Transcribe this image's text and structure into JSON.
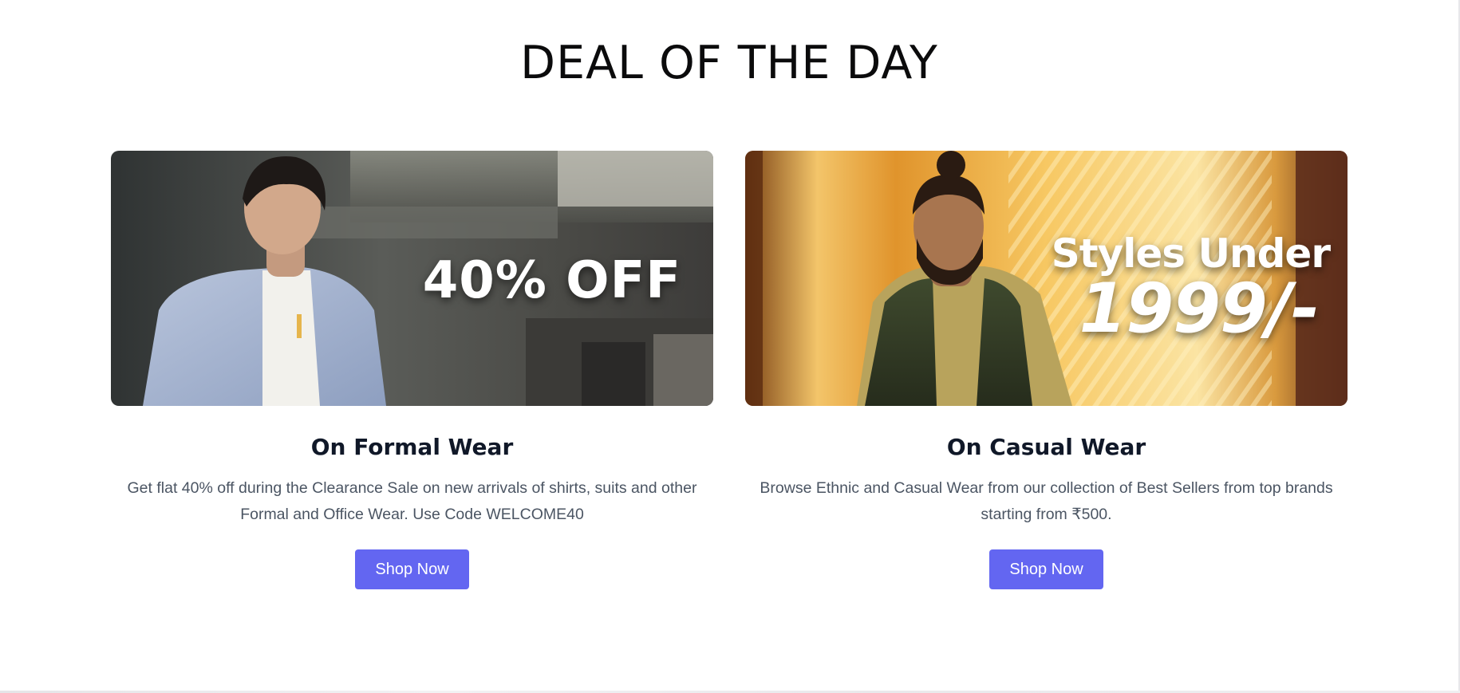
{
  "section": {
    "title": "DEAL OF THE DAY"
  },
  "cards": [
    {
      "banner_text": "40% OFF",
      "title": "On Formal Wear",
      "description": "Get flat 40% off during the Clearance Sale on new arrivals of shirts, suits and other Formal and Office Wear. Use Code WELCOME40",
      "button_label": "Shop Now"
    },
    {
      "banner_text_top": "Styles Under",
      "banner_text_price": "1999/-",
      "title": "On Casual Wear",
      "description": "Browse Ethnic and Casual Wear from our collection of Best Sellers from top brands starting from ₹500.",
      "button_label": "Shop Now"
    }
  ],
  "colors": {
    "accent": "#6366f1",
    "heading": "#101828",
    "body_text": "#4b5563"
  }
}
